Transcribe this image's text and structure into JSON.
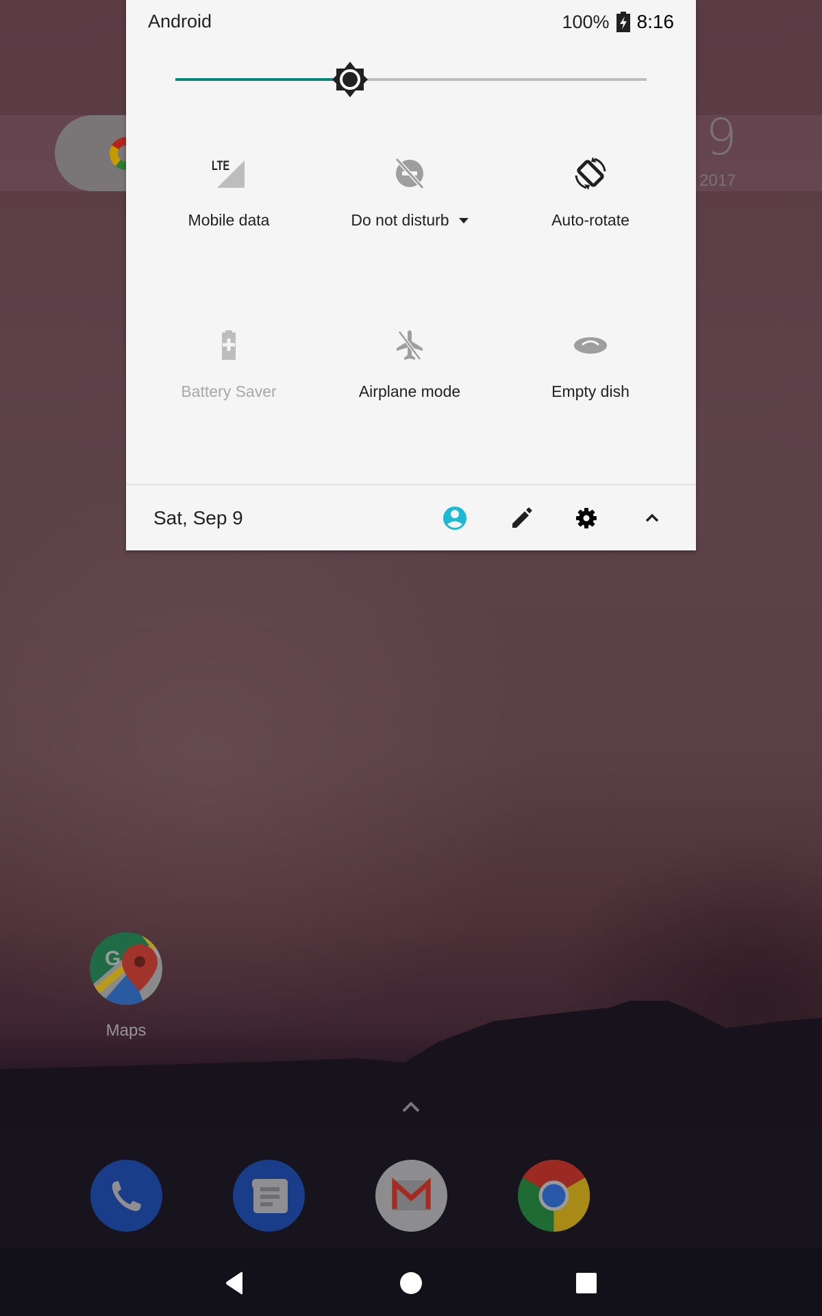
{
  "status_bar": {
    "carrier": "Android",
    "battery_percent": "100%",
    "battery_state": "charging",
    "time": "8:16"
  },
  "brightness": {
    "level_fraction": 0.37,
    "accent_color": "#00897B",
    "icon": "brightness-icon"
  },
  "tiles": [
    {
      "id": "mobile-data",
      "label": "Mobile data",
      "icon": "lte-signal-icon",
      "state": "off",
      "has_dropdown": false
    },
    {
      "id": "do-not-disturb",
      "label": "Do not disturb",
      "icon": "dnd-off-icon",
      "state": "off",
      "has_dropdown": true
    },
    {
      "id": "auto-rotate",
      "label": "Auto-rotate",
      "icon": "screen-rotation-icon",
      "state": "on",
      "has_dropdown": false
    },
    {
      "id": "battery-saver",
      "label": "Battery Saver",
      "icon": "battery-plus-icon",
      "state": "unavailable",
      "has_dropdown": false
    },
    {
      "id": "airplane-mode",
      "label": "Airplane mode",
      "icon": "airplane-off-icon",
      "state": "off",
      "has_dropdown": false
    },
    {
      "id": "empty-dish",
      "label": "Empty dish",
      "icon": "dish-icon",
      "state": "off",
      "has_dropdown": false
    }
  ],
  "footer": {
    "date": "Sat, Sep 9",
    "buttons": [
      {
        "id": "user",
        "icon": "user-account-icon",
        "color": "#1CB8D4"
      },
      {
        "id": "edit",
        "icon": "pencil-icon"
      },
      {
        "id": "settings",
        "icon": "gear-icon"
      },
      {
        "id": "collapse",
        "icon": "chevron-up-icon"
      }
    ]
  },
  "home_screen": {
    "date_widget": {
      "day": "9",
      "year": "2017"
    },
    "apps": [
      {
        "label": "Maps",
        "icon": "google-maps-icon"
      }
    ],
    "dock": [
      {
        "name": "Phone",
        "icon": "phone-icon"
      },
      {
        "name": "Messages",
        "icon": "messages-icon"
      },
      {
        "name": "Gmail",
        "icon": "gmail-icon"
      },
      {
        "name": "Chrome",
        "icon": "chrome-icon"
      }
    ]
  },
  "navigation_bar": {
    "buttons": [
      "back",
      "home",
      "recents"
    ]
  }
}
